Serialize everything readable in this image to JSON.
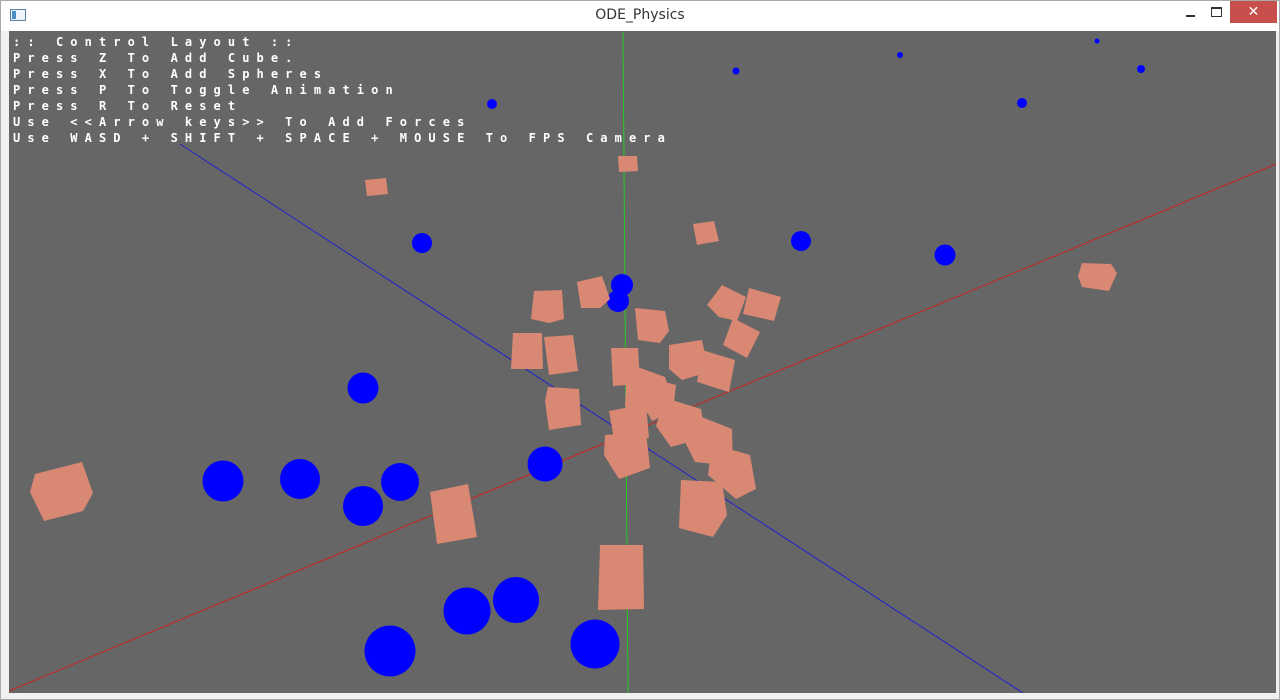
{
  "window": {
    "title": "ODE_Physics",
    "close_glyph": "✕"
  },
  "help_lines": [
    ":: Control Layout ::",
    "Press Z To Add Cube.",
    "Press X To Add Spheres",
    "Press P To Toggle Animation",
    "Press R To Reset",
    "Use <<Arrow keys>> To Add Forces",
    "Use WASD + SHIFT + SPACE + MOUSE To FPS Camera"
  ],
  "scene": {
    "background": "#666666",
    "axis_colors": {
      "x": "#cc2222",
      "y": "#22cc22",
      "z": "#2222cc"
    },
    "cube_color": "#d98873",
    "sphere_color": "#0000ff",
    "object_types": [
      "cube",
      "sphere"
    ]
  }
}
